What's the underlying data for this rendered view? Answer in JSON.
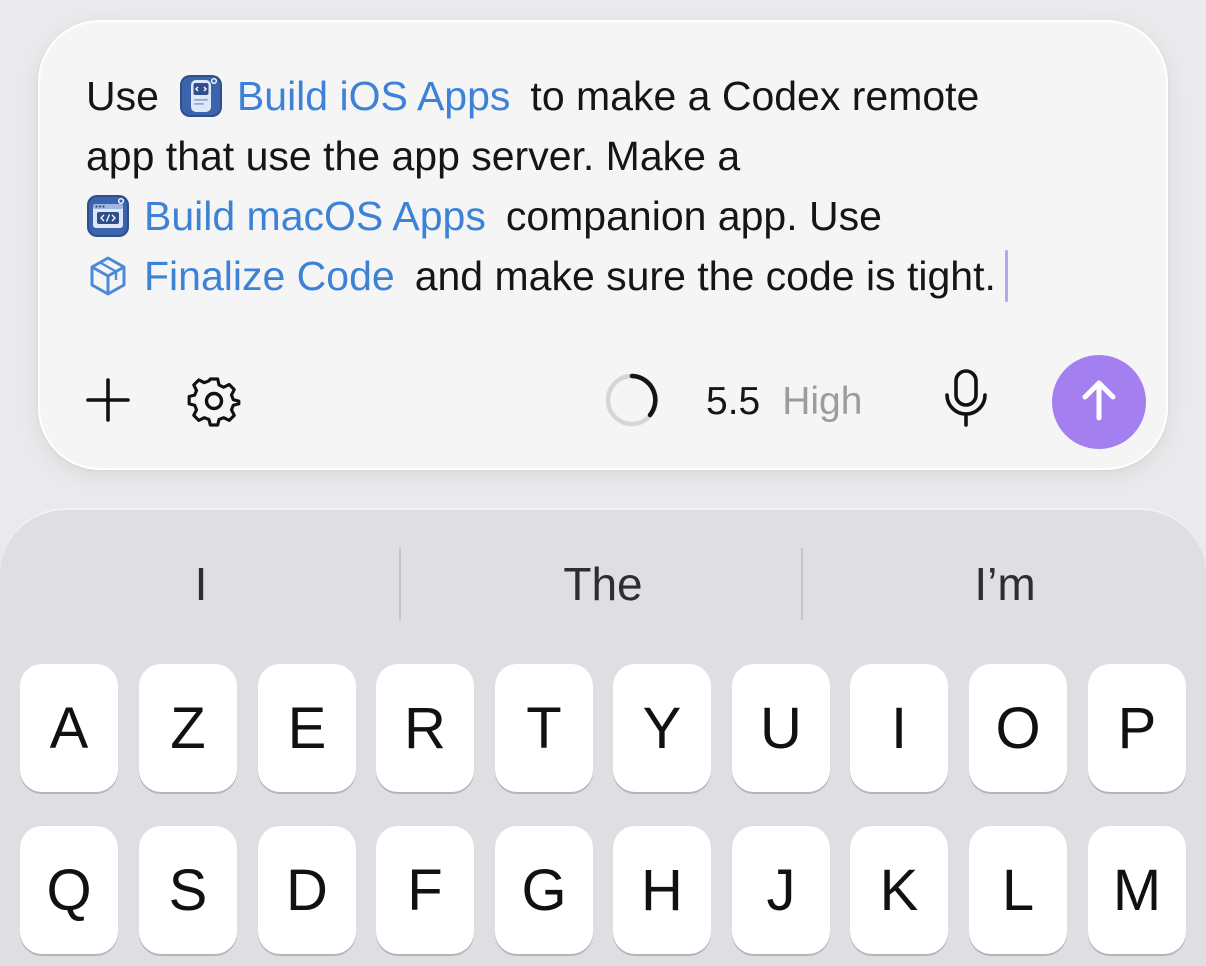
{
  "composer": {
    "prompt": {
      "line1": {
        "before": "Use",
        "chip_label": "Build iOS Apps",
        "chip_icon": "ios-app-builder-icon",
        "after": "to make a Codex remote"
      },
      "line2": {
        "text": "app that use the app server. Make a"
      },
      "line3": {
        "chip_label": "Build macOS Apps",
        "chip_icon": "macos-app-builder-icon",
        "after": "companion app. Use"
      },
      "line4": {
        "chip_label": "Finalize Code",
        "chip_icon": "cube-icon",
        "after": "and make sure the code is tight."
      }
    },
    "toolbar": {
      "add_icon": "plus-icon",
      "settings_icon": "gear-icon",
      "progress_icon": "progress-ring-icon",
      "model_version": "5.5",
      "model_effort": "High",
      "mic_icon": "microphone-icon",
      "send_icon": "arrow-up-icon"
    },
    "colors": {
      "chip_text": "#3d82d6",
      "send_button": "#a47ff0",
      "caret": "#b9a2ef"
    }
  },
  "keyboard": {
    "suggestions": [
      "I",
      "The",
      "I’m"
    ],
    "rows": [
      [
        "A",
        "Z",
        "E",
        "R",
        "T",
        "Y",
        "U",
        "I",
        "O",
        "P"
      ],
      [
        "Q",
        "S",
        "D",
        "F",
        "G",
        "H",
        "J",
        "K",
        "L",
        "M"
      ]
    ]
  }
}
